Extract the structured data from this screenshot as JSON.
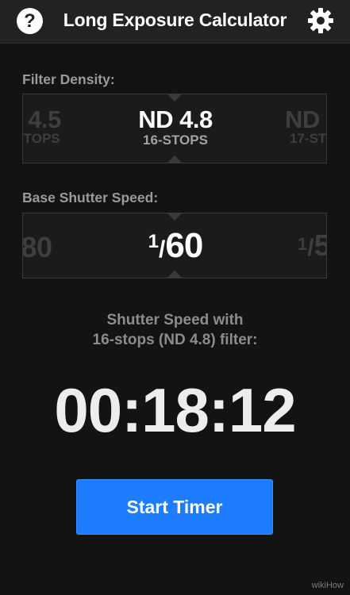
{
  "header": {
    "title": "Long Exposure Calculator",
    "help_glyph": "?",
    "help_icon": "question-circle-icon",
    "settings_icon": "gear-icon"
  },
  "filter_density": {
    "label": "Filter Density:",
    "prev": {
      "value": "4.5",
      "sub": "STOPS"
    },
    "selected": {
      "value": "ND 4.8",
      "sub": "16-STOPS"
    },
    "next": {
      "value": "ND",
      "sub": "17-ST"
    }
  },
  "base_shutter": {
    "label": "Base Shutter Speed:",
    "prev": {
      "value": "80"
    },
    "selected": {
      "numerator": "1",
      "slash": "/",
      "denominator": "60"
    },
    "next": {
      "numerator": "1",
      "slash": "/",
      "denominator": "5"
    }
  },
  "result": {
    "caption_line1": "Shutter Speed with",
    "caption_line2": "16-stops (ND 4.8) filter:",
    "time": "00:18:12"
  },
  "start_button": {
    "label": "Start Timer"
  },
  "watermark": "wikiHow",
  "colors": {
    "accent": "#1e7cff",
    "background": "#131313",
    "header": "#222222"
  }
}
